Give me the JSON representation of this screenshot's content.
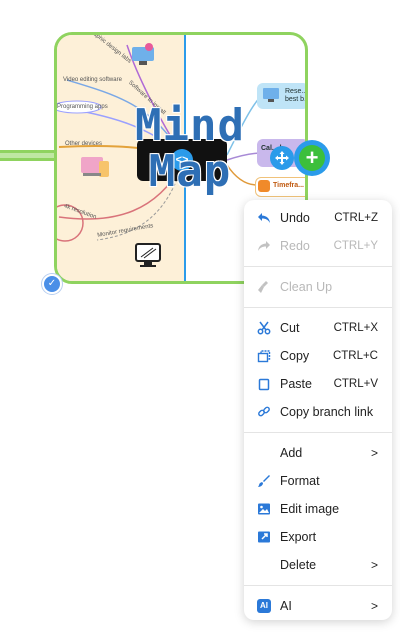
{
  "canvas": {
    "title_line1": "Mind",
    "title_line2": "Map",
    "branch_labels": {
      "graphic_design": "Graphic design labs",
      "video_editing": "Video editing software",
      "software_to_install": "Software to install",
      "programming_apps": "Programming apps",
      "other_devices": "Other devices",
      "resolution": "4k resolution",
      "monitor_requirements": "Monitor requirements",
      "research": "Rese... best b...",
      "calendar": "Cal... b...",
      "timeframe": "Timefra..."
    },
    "colors": {
      "accent": "#2b9bea",
      "card_border": "#8fd35f",
      "add_button": "#3cbf3c",
      "card_left_bg": "#fdf0d8"
    }
  },
  "menu": {
    "undo": {
      "label": "Undo",
      "shortcut": "CTRL+Z",
      "icon": "undo-arrow-icon"
    },
    "redo": {
      "label": "Redo",
      "shortcut": "CTRL+Y",
      "icon": "redo-arrow-icon"
    },
    "cleanup": {
      "label": "Clean Up",
      "icon": "broom-icon"
    },
    "cut": {
      "label": "Cut",
      "shortcut": "CTRL+X",
      "icon": "scissors-icon"
    },
    "copy": {
      "label": "Copy",
      "shortcut": "CTRL+C",
      "icon": "copy-icon"
    },
    "paste": {
      "label": "Paste",
      "shortcut": "CTRL+V",
      "icon": "paste-icon"
    },
    "copy_branch_link": {
      "label": "Copy branch link",
      "icon": "link-icon"
    },
    "add": {
      "label": "Add",
      "arrow": ">"
    },
    "format": {
      "label": "Format",
      "icon": "paint-brush-icon"
    },
    "edit_image": {
      "label": "Edit image",
      "icon": "image-icon"
    },
    "export": {
      "label": "Export",
      "icon": "export-icon"
    },
    "delete": {
      "label": "Delete",
      "arrow": ">"
    },
    "ai": {
      "label": "AI",
      "badge": "AI",
      "arrow": ">"
    }
  }
}
